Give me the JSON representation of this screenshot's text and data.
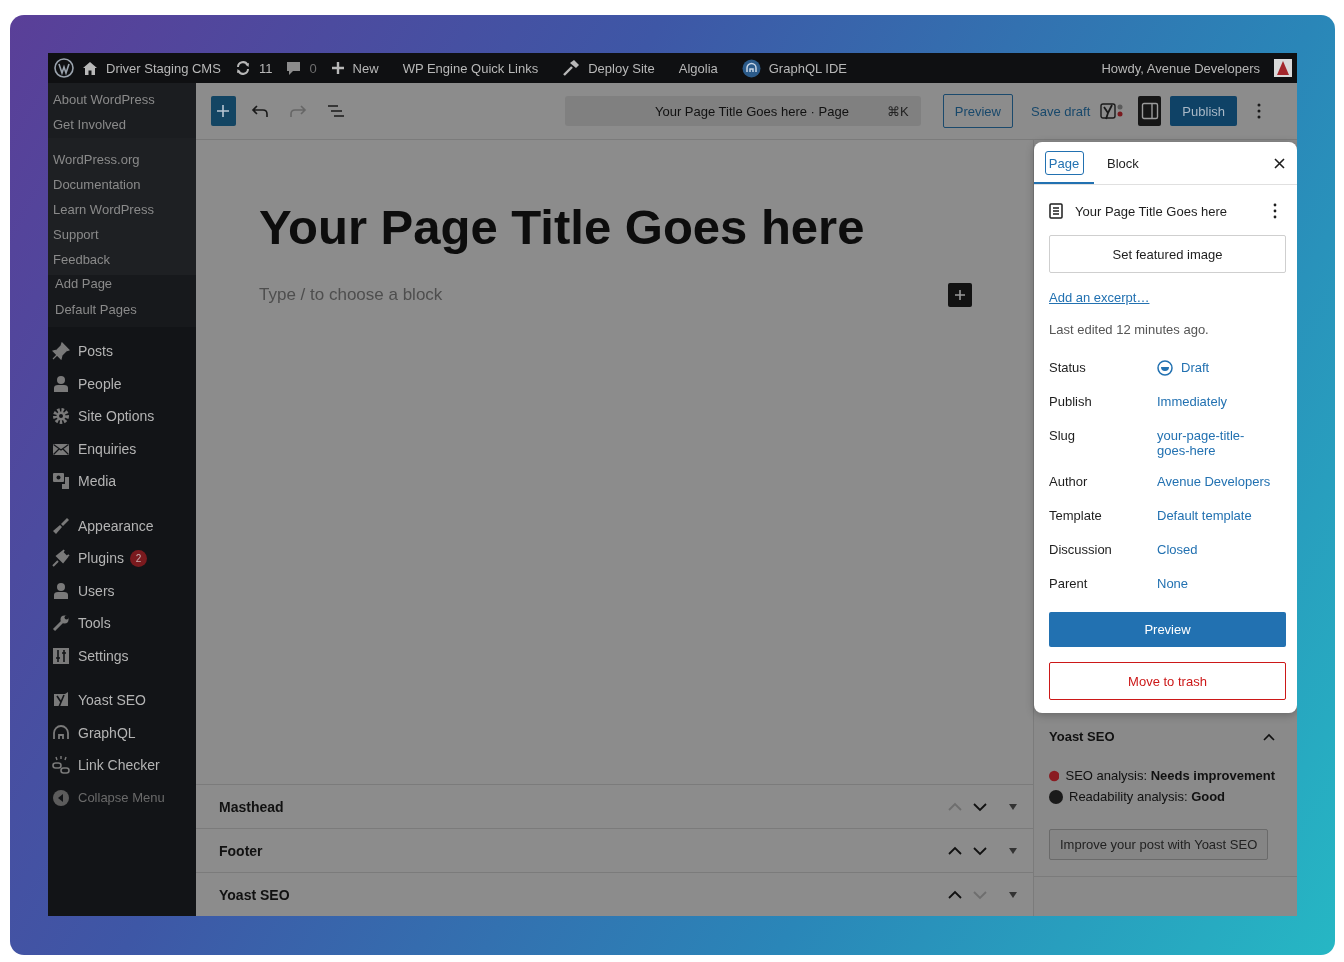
{
  "admin_bar": {
    "site": "Driver Staging CMS",
    "updates": "11",
    "comments": "0",
    "new": "New",
    "links": [
      "WP Engine Quick Links",
      "Deploy Site",
      "Algolia",
      "GraphQL IDE"
    ],
    "account": "Howdy, Avenue Developers"
  },
  "sidebar": {
    "flyout_sections": [
      [
        "About WordPress",
        "Get Involved"
      ],
      [
        "WordPress.org",
        "Documentation",
        "Learn WordPress",
        "Support",
        "Feedback"
      ]
    ],
    "submenu": [
      "Add Page",
      "Default Pages"
    ],
    "menu_groups": [
      {
        "items": [
          {
            "label": "Posts",
            "kind": "item"
          },
          {
            "label": "People",
            "kind": "item"
          },
          {
            "label": "Site Options",
            "kind": "item"
          },
          {
            "label": "Enquiries",
            "kind": "item"
          },
          {
            "label": "Media",
            "kind": "item"
          }
        ]
      },
      {
        "items": [
          {
            "label": "Appearance",
            "kind": "item"
          },
          {
            "label": "Plugins",
            "kind": "item",
            "badge": "2"
          },
          {
            "label": "Users",
            "kind": "item"
          },
          {
            "label": "Tools",
            "kind": "item"
          },
          {
            "label": "Settings",
            "kind": "item"
          }
        ]
      },
      {
        "items": [
          {
            "label": "Yoast SEO",
            "kind": "item"
          },
          {
            "label": "GraphQL",
            "kind": "item"
          },
          {
            "label": "Link Checker",
            "kind": "item"
          },
          {
            "label": "Collapse Menu",
            "kind": "collapse"
          }
        ]
      }
    ]
  },
  "toolbar": {
    "command": "Your Page Title Goes here · Page",
    "shortcut": "⌘K",
    "preview": "Preview",
    "save_draft": "Save draft",
    "publish": "Publish"
  },
  "editor": {
    "title": "Your Page Title Goes here",
    "empty_block_hint": "Type / to choose a block",
    "meta_boxes": [
      {
        "title": "Masthead",
        "up_disabled": true,
        "down_disabled": false
      },
      {
        "title": "Footer",
        "up_disabled": false,
        "down_disabled": false
      },
      {
        "title": "Yoast SEO",
        "up_disabled": false,
        "down_disabled": true
      }
    ]
  },
  "settings_panel": {
    "tabs": [
      {
        "label": "Page",
        "selected": true
      },
      {
        "label": "Block",
        "selected": false
      }
    ],
    "document_title": "Your Page Title Goes here",
    "featured_image": "Set featured image",
    "excerpt_link": "Add an excerpt…",
    "last_edited": "Last edited 12 minutes ago.",
    "fields": [
      {
        "label": "Status",
        "value": "Draft",
        "kind": "status"
      },
      {
        "label": "Publish",
        "value": "Immediately",
        "kind": "link"
      },
      {
        "label": "Slug",
        "value": "your-page-title-goes-here",
        "kind": "link"
      },
      {
        "label": "Author",
        "value": "Avenue Developers",
        "kind": "link"
      },
      {
        "label": "Template",
        "value": "Default template",
        "kind": "link"
      },
      {
        "label": "Discussion",
        "value": "Closed",
        "kind": "link"
      },
      {
        "label": "Parent",
        "value": "None",
        "kind": "link"
      }
    ],
    "preview": "Preview",
    "trash": "Move to trash"
  },
  "yoast_panel": {
    "title": "Yoast SEO",
    "expanded": true,
    "analyses": [
      {
        "text": "SEO analysis: **Needs improvement**",
        "color": "#8a1c22"
      },
      {
        "text": "Readability analysis: **Good**",
        "color": "#1a1a1a"
      }
    ],
    "button": "Improve your post with Yoast SEO"
  }
}
